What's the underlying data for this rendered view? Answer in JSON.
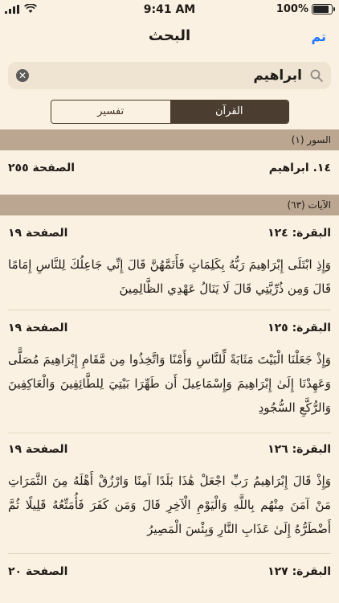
{
  "status": {
    "time": "9:41 AM",
    "battery": "100%",
    "battery_level": 1.0
  },
  "nav": {
    "title": "البحث",
    "done": "تم"
  },
  "search": {
    "query": "ابراهيم"
  },
  "tabs": [
    {
      "label": "القرآن",
      "active": true
    },
    {
      "label": "تفسير",
      "active": false
    }
  ],
  "surah_section": {
    "header": "السور (١)",
    "items": [
      {
        "title": "١٤. ابراهيم",
        "page": "الصفحة ٢٥٥"
      }
    ]
  },
  "ayat_section": {
    "header": "الآيات (٦٣)",
    "items": [
      {
        "ref": "البقرة: ١٢٤",
        "page": "الصفحة ١٩",
        "text": "وَإِذِ ابْتَلَى إِبْرَاهِيمَ رَبُّهُ بِكَلِمَاتٍ فَأَتَمَّهُنَّ قَالَ إِنِّي جَاعِلُكَ لِلنَّاسِ إِمَامًا قَالَ وَمِن ذُرِّيَّتِي قَالَ لَا يَنَالُ عَهْدِي الظَّالِمِينَ"
      },
      {
        "ref": "البقرة: ١٢٥",
        "page": "الصفحة ١٩",
        "text": "وَإِذْ جَعَلْنَا الْبَيْتَ مَثَابَةً لِّلنَّاسِ وَأَمْنًا وَاتَّخِذُوا مِن مَّقَامِ إِبْرَاهِيمَ مُصَلًّى وَعَهِدْنَا إِلَىٰ إِبْرَاهِيمَ وَإِسْمَاعِيلَ أَن طَهِّرَا بَيْتِيَ لِلطَّائِفِينَ وَالْعَاكِفِينَ وَالرُّكَّعِ السُّجُودِ"
      },
      {
        "ref": "البقرة: ١٢٦",
        "page": "الصفحة ١٩",
        "text": "وَإِذْ قَالَ إِبْرَاهِيمُ رَبِّ اجْعَلْ هَٰذَا بَلَدًا آمِنًا وَارْزُقْ أَهْلَهُ مِنَ الثَّمَرَاتِ مَنْ آمَنَ مِنْهُم بِاللَّهِ وَالْيَوْمِ الْآخِرِ قَالَ وَمَن كَفَرَ فَأُمَتِّعُهُ قَلِيلًا ثُمَّ أَضْطَرُّهُ إِلَىٰ عَذَابِ النَّارِ وَبِئْسَ الْمَصِيرُ"
      },
      {
        "ref": "البقرة: ١٢٧",
        "page": "الصفحة ٢٠"
      }
    ]
  }
}
